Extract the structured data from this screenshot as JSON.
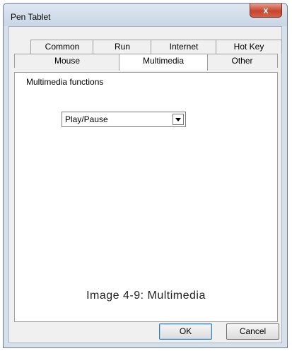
{
  "window": {
    "title": "Pen Tablet",
    "close_label": "x"
  },
  "tabs": {
    "row1": [
      "Common",
      "Run",
      "Internet",
      "Hot Key"
    ],
    "row2": [
      "Mouse",
      "Multimedia",
      "Other"
    ],
    "active": "Multimedia"
  },
  "multimedia": {
    "section_label": "Multimedia functions",
    "selected_value": "Play/Pause"
  },
  "caption": "Image 4-9: Multimedia",
  "buttons": {
    "ok": "OK",
    "cancel": "Cancel"
  }
}
